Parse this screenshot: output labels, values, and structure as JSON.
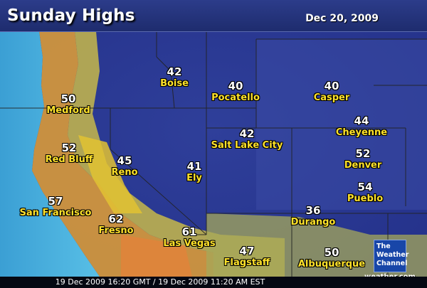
{
  "header": {
    "title": "Sunday Highs",
    "date": "Dec 20, 2009"
  },
  "cities": [
    {
      "name": "Boise",
      "temp": "42"
    },
    {
      "name": "Pocatello",
      "temp": "40"
    },
    {
      "name": "Casper",
      "temp": "40"
    },
    {
      "name": "Medford",
      "temp": "50"
    },
    {
      "name": "Cheyenne",
      "temp": "44"
    },
    {
      "name": "Salt Lake City",
      "temp": "42"
    },
    {
      "name": "Red Bluff",
      "temp": "52"
    },
    {
      "name": "Denver",
      "temp": "52"
    },
    {
      "name": "Reno",
      "temp": "45"
    },
    {
      "name": "Ely",
      "temp": "41"
    },
    {
      "name": "Pueblo",
      "temp": "54"
    },
    {
      "name": "San Francisco",
      "temp": "57"
    },
    {
      "name": "Durango",
      "temp": "36"
    },
    {
      "name": "Fresno",
      "temp": "62"
    },
    {
      "name": "Las Vegas",
      "temp": "61"
    },
    {
      "name": "Flagstaff",
      "temp": "47"
    },
    {
      "name": "Albuquerque",
      "temp": "50"
    }
  ],
  "footer": {
    "timestamp": "19 Dec 2009 16:20 GMT / 19 Dec 2009 11:20 AM EST"
  },
  "logo": {
    "line1": "The",
    "line2": "Weather",
    "line3": "Channel",
    "site": "weather.com"
  },
  "colors": {
    "cold": "#3847a6",
    "cool": "#5d74c2",
    "mild": "#d8c33a",
    "warm": "#e28a3a",
    "ocean": "#4fb2d8"
  }
}
